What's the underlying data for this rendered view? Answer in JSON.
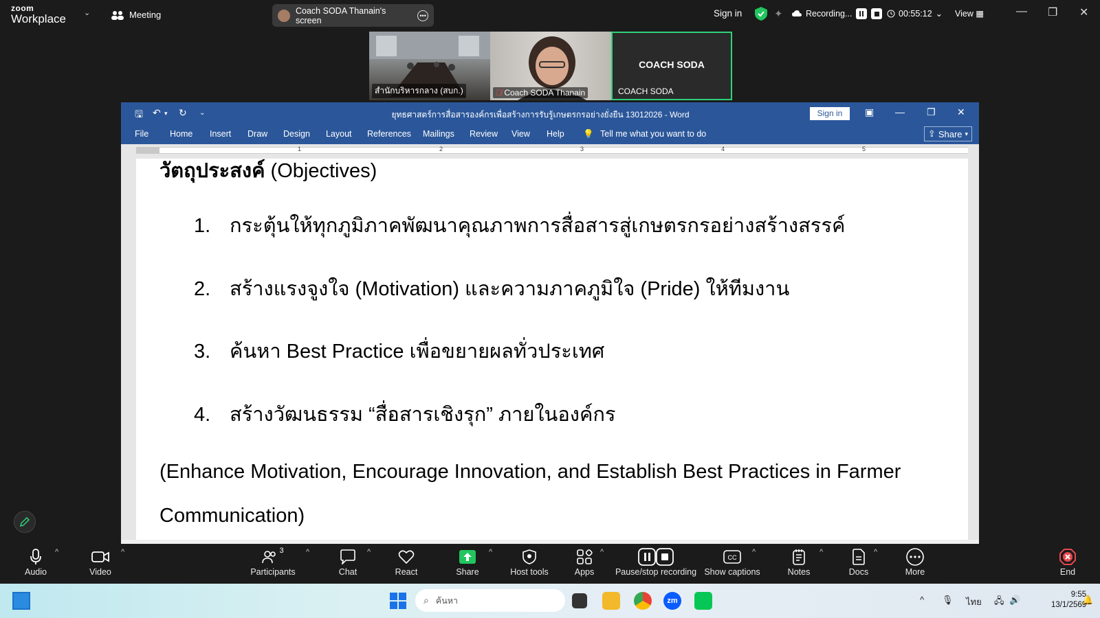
{
  "zoom": {
    "logo_top": "zoom",
    "logo_bottom": "Workplace",
    "meeting_label": "Meeting",
    "screen_share_label": "Coach SODA Thanain's screen",
    "sign_in": "Sign in",
    "recording_label": "Recording...",
    "timer": "00:55:12",
    "view_label": "View"
  },
  "video_tiles": [
    {
      "name": "สำนักบริหารกลาง (สบก.)"
    },
    {
      "name": "Coach SODA Thanain"
    },
    {
      "name": "COACH SODA",
      "center_label": "COACH SODA"
    }
  ],
  "word": {
    "doc_title": "ยุทธศาสตร์การสื่อสารองค์กรเพื่อสร้างการรับรู้เกษตรกรอย่างยั่งยืน 13012026 - Word",
    "sign_in": "Sign in",
    "menu": [
      "File",
      "Home",
      "Insert",
      "Draw",
      "Design",
      "Layout",
      "References",
      "Mailings",
      "Review",
      "View",
      "Help"
    ],
    "tell_me": "Tell me what you want to do",
    "share": "Share",
    "ruler_numbers": [
      "1",
      "2",
      "3",
      "4",
      "5"
    ],
    "heading_thai": "วัตถุประสงค์",
    "heading_en": " (Objectives)",
    "list": [
      {
        "num": "1.",
        "text": "กระตุ้นให้ทุกภูมิภาคพัฒนาคุณภาพการสื่อสารสู่เกษตรกรอย่างสร้างสรรค์"
      },
      {
        "num": "2.",
        "text": "สร้างแรงจูงใจ (Motivation) และความภาคภูมิใจ (Pride) ให้ทีมงาน"
      },
      {
        "num": "3.",
        "text": "ค้นหา Best Practice เพื่อขยายผลทั่วประเทศ"
      },
      {
        "num": "4.",
        "text": "สร้างวัฒนธรรม “สื่อสารเชิงรุก” ภายในองค์กร"
      }
    ],
    "para_line1": "(Enhance Motivation, Encourage Innovation, and Establish Best Practices in Farmer",
    "para_line2": "Communication)"
  },
  "toolbar": {
    "audio": "Audio",
    "video": "Video",
    "participants": "Participants",
    "participants_count": "3",
    "chat": "Chat",
    "react": "React",
    "share": "Share",
    "host_tools": "Host tools",
    "apps": "Apps",
    "pause_stop": "Pause/stop recording",
    "captions": "Show captions",
    "notes": "Notes",
    "docs": "Docs",
    "more": "More",
    "end": "End"
  },
  "taskbar": {
    "search_placeholder": "ค้นหา",
    "lang": "ไทย",
    "time": "9:55",
    "date": "13/1/2569"
  },
  "colors": {
    "word_blue": "#2b579a",
    "zoom_bg": "#1b1b1b",
    "share_green": "#22c55e",
    "end_red": "#e5484d",
    "speaker_border": "#2fd27a"
  }
}
